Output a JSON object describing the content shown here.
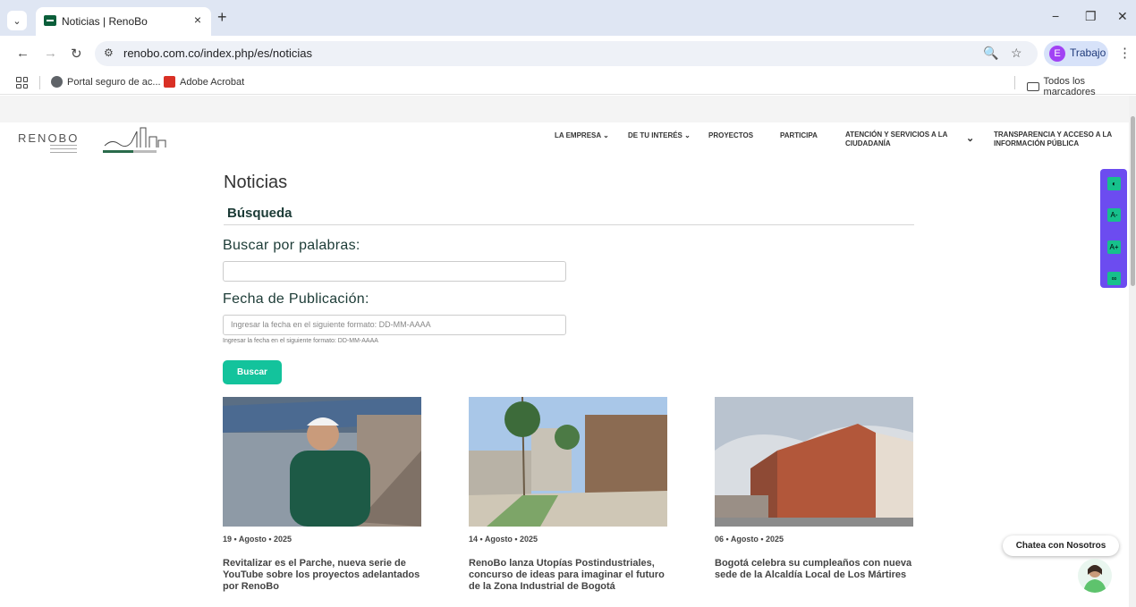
{
  "browser": {
    "tab_title": "Noticias | RenoBo",
    "url": "renobo.com.co/index.php/es/noticias",
    "profile_initial": "E",
    "profile_label": "Trabajo",
    "bookmarks": [
      "Portal seguro de ac...",
      "Adobe Acrobat"
    ],
    "all_bookmarks": "Todos los marcadores"
  },
  "site": {
    "logo_text": "RENOBO",
    "nav": [
      {
        "label": "LA EMPRESA",
        "has_dropdown": true
      },
      {
        "label": "DE TU INTERÉS",
        "has_dropdown": true
      },
      {
        "label": "PROYECTOS",
        "has_dropdown": false
      },
      {
        "label": "PARTICIPA",
        "has_dropdown": false
      },
      {
        "label": "ATENCIÓN Y SERVICIOS A LA CIUDADANÍA",
        "has_dropdown": true
      },
      {
        "label": "TRANSPARENCIA Y ACCESO A LA INFORMACIÓN PÚBLICA",
        "has_dropdown": false
      }
    ]
  },
  "page": {
    "title": "Noticias",
    "search_heading": "Búsqueda",
    "keyword_label": "Buscar por palabras:",
    "keyword_value": "",
    "date_label": "Fecha de Publicación:",
    "date_placeholder": "Ingresar la fecha en el siguiente formato: DD-MM-AAAA",
    "date_hint": "Ingresar la fecha en el siguiente formato: DD-MM-AAAA",
    "search_button": "Buscar"
  },
  "news": [
    {
      "date": "19 • Agosto • 2025",
      "title": "Revitalizar es el Parche, nueva serie de YouTube sobre los proyectos adelantados por RenoBo"
    },
    {
      "date": "14 • Agosto • 2025",
      "title": "RenoBo lanza Utopías Postindustriales, concurso de ideas para imaginar el futuro de la Zona Industrial de Bogotá"
    },
    {
      "date": "06 • Agosto • 2025",
      "title": "Bogotá celebra su cumpleaños con nueva sede de la Alcaldía Local de Los Mártires"
    }
  ],
  "widgets": {
    "a11y_buttons": [
      "contrast-icon",
      "A-",
      "A+",
      "binoculars-icon"
    ],
    "chat_label": "Chatea con Nosotros"
  },
  "colors": {
    "accent": "#13c39c",
    "a11y_bar": "#6c4cf0",
    "heading": "#1c3b36"
  }
}
